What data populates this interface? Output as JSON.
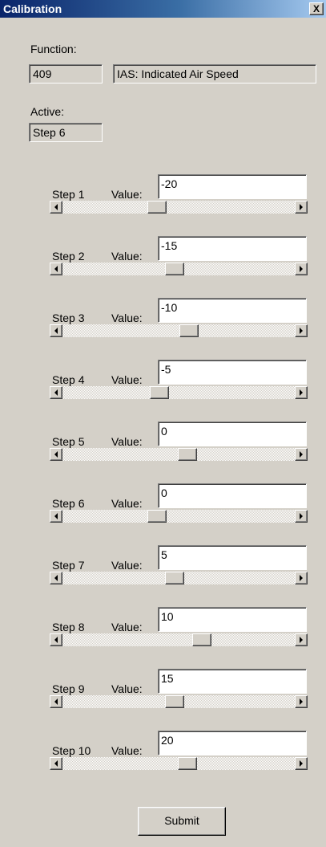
{
  "window": {
    "title": "Calibration",
    "close_label": "X"
  },
  "function": {
    "label": "Function:",
    "code": "409",
    "description": "IAS: Indicated Air Speed"
  },
  "active": {
    "label": "Active:",
    "value": "Step 6"
  },
  "value_label": "Value:",
  "steps": [
    {
      "label": "Step 1",
      "value": "-20",
      "slider_position": 0.4
    },
    {
      "label": "Step 2",
      "value": "-15",
      "slider_position": 0.48
    },
    {
      "label": "Step 3",
      "value": "-10",
      "slider_position": 0.55
    },
    {
      "label": "Step 4",
      "value": "-5",
      "slider_position": 0.41
    },
    {
      "label": "Step 5",
      "value": "0",
      "slider_position": 0.54
    },
    {
      "label": "Step 6",
      "value": "0",
      "slider_position": 0.4
    },
    {
      "label": "Step 7",
      "value": "5",
      "slider_position": 0.48
    },
    {
      "label": "Step 8",
      "value": "10",
      "slider_position": 0.61
    },
    {
      "label": "Step 9",
      "value": "15",
      "slider_position": 0.48
    },
    {
      "label": "Step 10",
      "value": "20",
      "slider_position": 0.54
    }
  ],
  "submit_label": "Submit"
}
